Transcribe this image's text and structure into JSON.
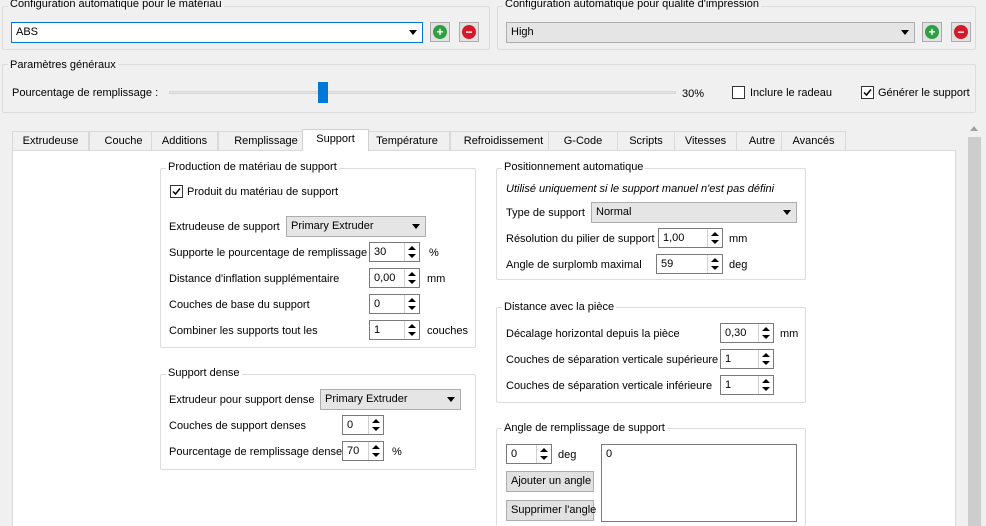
{
  "material_config": {
    "legend": "Configuration automatique pour le matériau",
    "selected": "ABS"
  },
  "quality_config": {
    "legend": "Configuration automatique pour qualité d'impression",
    "selected": "High"
  },
  "icons": {
    "add": "+",
    "remove": "−"
  },
  "general": {
    "legend": "Paramètres généraux",
    "infill_label": "Pourcentage de remplissage :",
    "infill_value": "30%",
    "infill_fraction": 0.3,
    "raft_label": "Inclure le radeau",
    "raft_checked": false,
    "support_label": "Générer le support",
    "support_checked": true
  },
  "tabs": [
    "Extrudeuse",
    "Couche",
    "Additions",
    "Remplissage",
    "Support",
    "Température",
    "Refroidissement",
    "G-Code",
    "Scripts",
    "Vitesses",
    "Autre",
    "Avancés"
  ],
  "active_tab": "Support",
  "production": {
    "legend": "Production de matériau de support",
    "produce_label": "Produit du matériau de support",
    "extruder_label": "Extrudeuse de support",
    "extruder_value": "Primary Extruder",
    "infill_pct_label": "Supporte le pourcentage de remplissage",
    "infill_pct_value": "30",
    "infill_pct_unit": "%",
    "inflation_label": "Distance d'inflation supplémentaire",
    "inflation_value": "0,00",
    "inflation_unit": "mm",
    "base_layers_label": "Couches de base du support",
    "base_layers_value": "0",
    "combine_label": "Combiner les supports tout les",
    "combine_value": "1",
    "combine_unit": "couches"
  },
  "dense": {
    "legend": "Support dense",
    "extruder_label": "Extrudeur pour support dense",
    "extruder_value": "Primary Extruder",
    "layers_label": "Couches de support denses",
    "layers_value": "0",
    "pct_label": "Pourcentage de remplissage dense",
    "pct_value": "70",
    "pct_unit": "%"
  },
  "positioning": {
    "legend": "Positionnement automatique",
    "note": "Utilisé uniquement si le support manuel n'est pas défini",
    "type_label": "Type de support",
    "type_value": "Normal",
    "resolution_label": "Résolution du pilier de support",
    "resolution_value": "1,00",
    "resolution_unit": "mm",
    "overhang_label": "Angle de surplomb maximal",
    "overhang_value": "59",
    "overhang_unit": "deg"
  },
  "distance": {
    "legend": "Distance avec la pièce",
    "horizontal_label": "Décalage horizontal depuis la pièce",
    "horizontal_value": "0,30",
    "horizontal_unit": "mm",
    "top_label": "Couches de séparation verticale supérieure",
    "top_value": "1",
    "bottom_label": "Couches de séparation verticale inférieure",
    "bottom_value": "1"
  },
  "angle": {
    "legend": "Angle de remplissage de support",
    "value": "0",
    "unit": "deg",
    "add_label": "Ajouter un angle",
    "remove_label": "Supprimer l'angle",
    "list_items": [
      "0"
    ]
  }
}
